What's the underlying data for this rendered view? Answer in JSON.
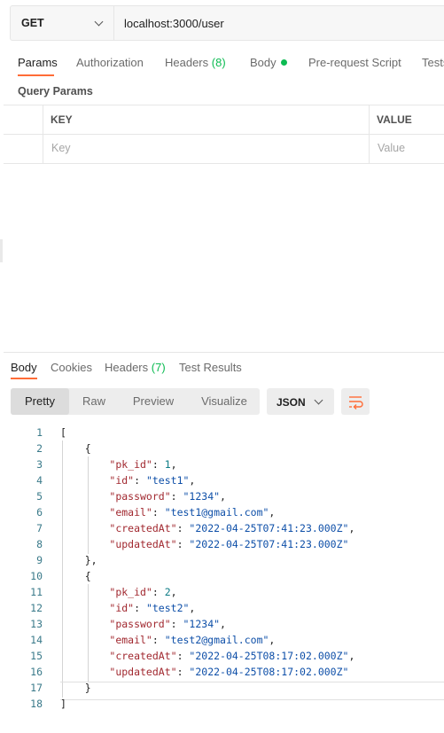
{
  "request": {
    "method": "GET",
    "url": "localhost:3000/user",
    "tabs": {
      "params": "Params",
      "authorization": "Authorization",
      "headers": "Headers",
      "headers_count": "(8)",
      "body": "Body",
      "prerequest": "Pre-request Script",
      "tests": "Tests"
    },
    "query_params": {
      "title": "Query Params",
      "key_header": "KEY",
      "value_header": "VALUE",
      "key_placeholder": "Key",
      "value_placeholder": "Value"
    }
  },
  "response": {
    "tabs": {
      "body": "Body",
      "cookies": "Cookies",
      "headers": "Headers",
      "headers_count": "(7)",
      "test_results": "Test Results"
    },
    "view_modes": [
      "Pretty",
      "Raw",
      "Preview",
      "Visualize"
    ],
    "active_view": "Pretty",
    "format": "JSON",
    "code_lines": [
      {
        "no": "1",
        "text": "["
      },
      {
        "no": "2",
        "text": "    {"
      },
      {
        "no": "3",
        "key": "\"pk_id\"",
        "val": "1",
        "num": true,
        "comma": true
      },
      {
        "no": "4",
        "key": "\"id\"",
        "val": "\"test1\"",
        "comma": true
      },
      {
        "no": "5",
        "key": "\"password\"",
        "val": "\"1234\"",
        "comma": true
      },
      {
        "no": "6",
        "key": "\"email\"",
        "val": "\"test1@gmail.com\"",
        "comma": true
      },
      {
        "no": "7",
        "key": "\"createdAt\"",
        "val": "\"2022-04-25T07:41:23.000Z\"",
        "comma": true
      },
      {
        "no": "8",
        "key": "\"updatedAt\"",
        "val": "\"2022-04-25T07:41:23.000Z\"",
        "comma": false
      },
      {
        "no": "9",
        "text": "    },"
      },
      {
        "no": "10",
        "text": "    {"
      },
      {
        "no": "11",
        "key": "\"pk_id\"",
        "val": "2",
        "num": true,
        "comma": true
      },
      {
        "no": "12",
        "key": "\"id\"",
        "val": "\"test2\"",
        "comma": true
      },
      {
        "no": "13",
        "key": "\"password\"",
        "val": "\"1234\"",
        "comma": true
      },
      {
        "no": "14",
        "key": "\"email\"",
        "val": "\"test2@gmail.com\"",
        "comma": true
      },
      {
        "no": "15",
        "key": "\"createdAt\"",
        "val": "\"2022-04-25T08:17:02.000Z\"",
        "comma": true
      },
      {
        "no": "16",
        "key": "\"updatedAt\"",
        "val": "\"2022-04-25T08:17:02.000Z\"",
        "comma": false
      },
      {
        "no": "17",
        "text": "    }"
      },
      {
        "no": "18",
        "text": "]"
      }
    ]
  },
  "colors": {
    "accent": "#ff6c37",
    "green": "#0cbb52",
    "json_key": "#a1282f",
    "json_string": "#0e4fa8",
    "json_number": "#0e7c86"
  },
  "icons": {
    "method_dropdown": "chevron-down-icon",
    "format_dropdown": "chevron-down-icon",
    "wrap": "wrap-lines-icon"
  }
}
